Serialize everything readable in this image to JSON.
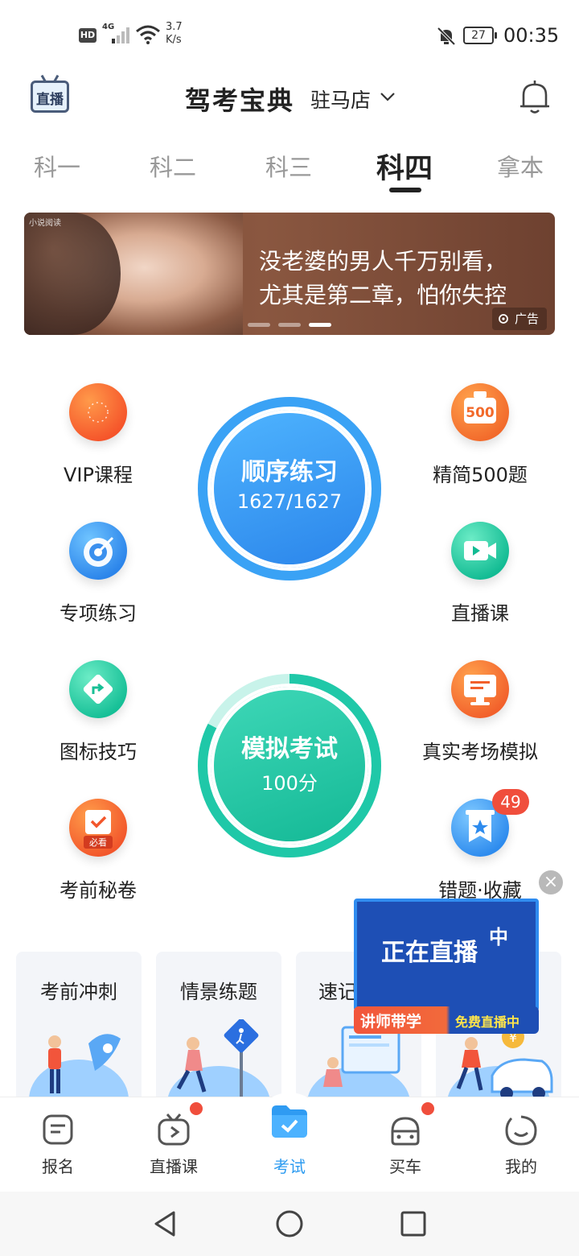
{
  "status_bar": {
    "hd": "HD",
    "network": "4G",
    "speed": "3.7\nK/s",
    "battery": "27",
    "time": "00:35"
  },
  "header": {
    "live_badge": "直播",
    "title": "驾考宝典",
    "location": "驻马店"
  },
  "tabs": [
    {
      "label": "科一",
      "active": false
    },
    {
      "label": "科二",
      "active": false
    },
    {
      "label": "科三",
      "active": false
    },
    {
      "label": "科四",
      "active": true
    },
    {
      "label": "拿本",
      "active": false
    }
  ],
  "banner": {
    "source": "小说阅读",
    "line1": "没老婆的男人千万别看，",
    "line2": "尤其是第二章，怕你失控",
    "ad_label": "广告",
    "dots": 3,
    "active_dot": 3
  },
  "features": {
    "vip": "VIP课程",
    "special": "专项练习",
    "signs": "图标技巧",
    "secret": "考前秘卷",
    "secret_badge": "必看",
    "select500": "精简500题",
    "select500_num": "500",
    "live": "直播课",
    "real_exam": "真实考场模拟",
    "mistakes": "错题·收藏",
    "mistakes_count": "49"
  },
  "practice": {
    "title": "顺序练习",
    "progress": "1627/1627",
    "fraction": 1.0
  },
  "mock_exam": {
    "title": "模拟考试",
    "score": "100分"
  },
  "cards": [
    {
      "title": "考前冲刺"
    },
    {
      "title": "情景练题"
    },
    {
      "title": "速记"
    },
    {
      "title": ""
    }
  ],
  "live_popup": {
    "main": "正在直播",
    "sup": "中",
    "strip_left": "讲师带学",
    "strip_right": "免费直播中",
    "close": "×"
  },
  "bottom_nav": [
    {
      "label": "报名",
      "icon": "form-icon",
      "active": false,
      "dot": false
    },
    {
      "label": "直播课",
      "icon": "tv-icon",
      "active": false,
      "dot": true
    },
    {
      "label": "考试",
      "icon": "exam-folder-icon",
      "active": true,
      "dot": false
    },
    {
      "label": "买车",
      "icon": "car-icon",
      "active": false,
      "dot": true
    },
    {
      "label": "我的",
      "icon": "smile-icon",
      "active": false,
      "dot": false
    }
  ],
  "colors": {
    "accent_blue": "#2d9bf0",
    "mock_green": "#1fc8a8",
    "badge_red": "#f04e3c"
  }
}
